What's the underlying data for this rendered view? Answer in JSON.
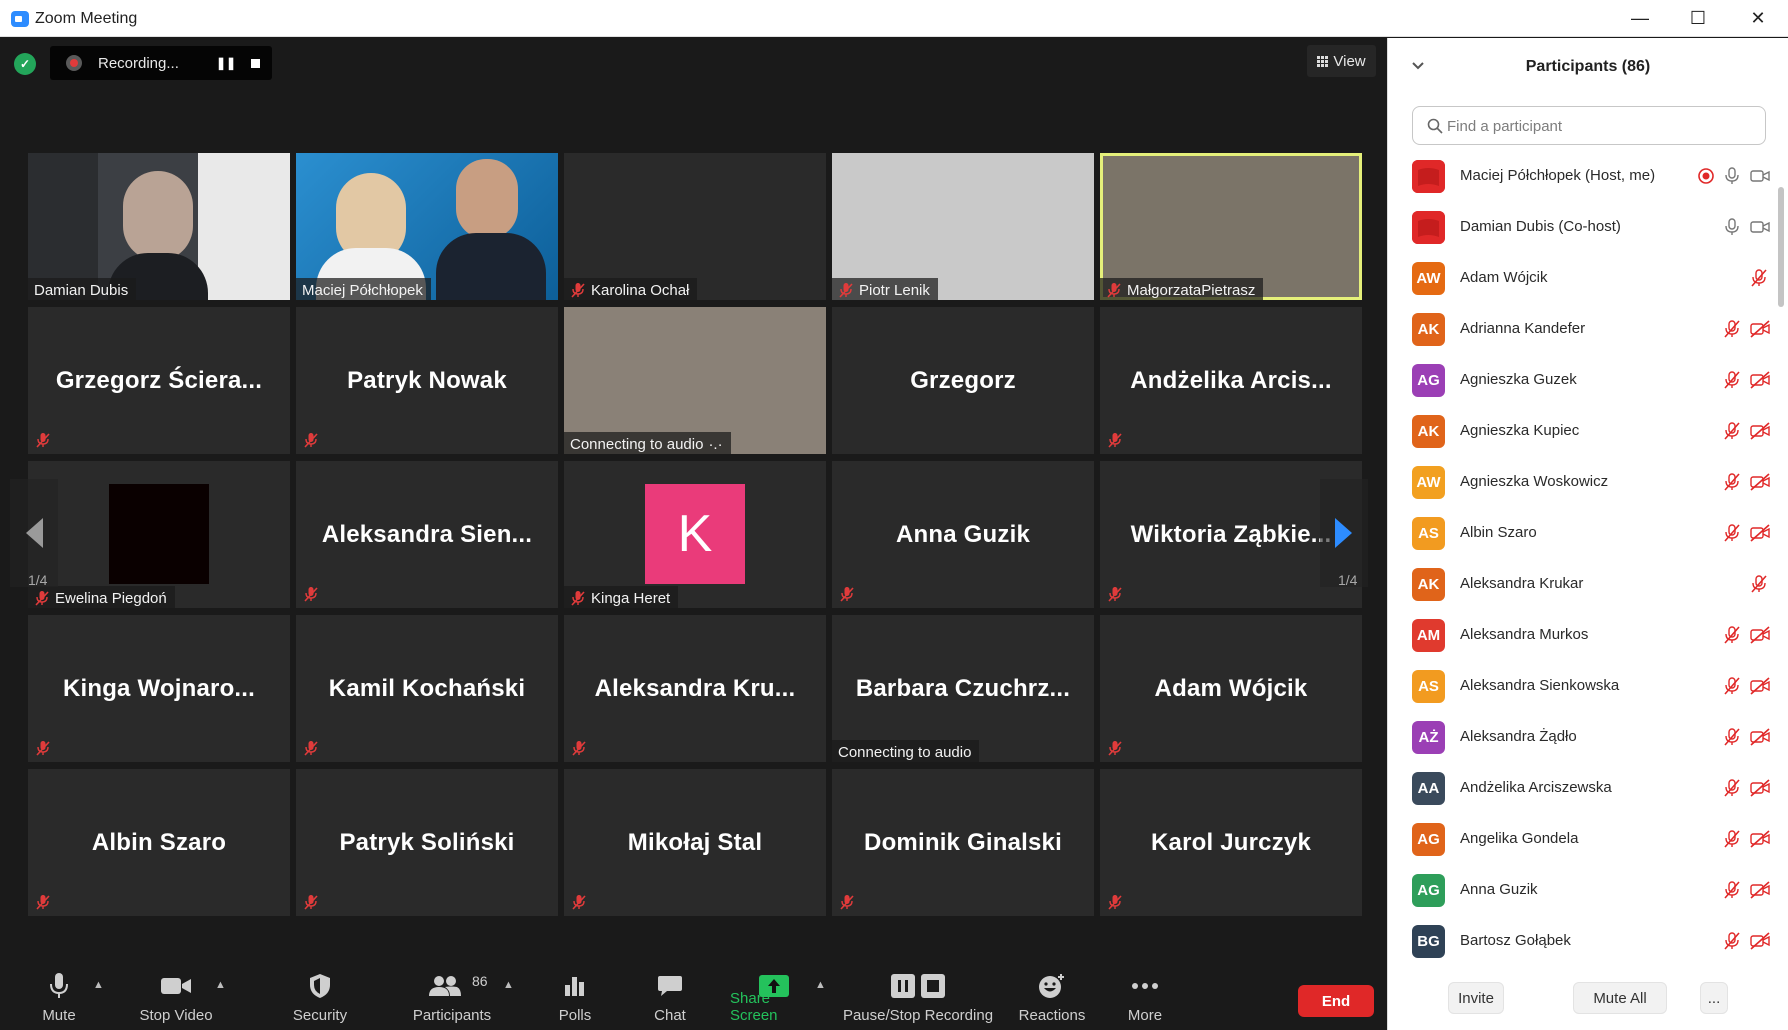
{
  "window": {
    "title": "Zoom Meeting",
    "minimize": "—",
    "maximize": "☐",
    "close": "✕"
  },
  "recording": {
    "label": "Recording...",
    "pause": "❚❚"
  },
  "view": {
    "label": "View"
  },
  "tiles": [
    {
      "name": "Damian Dubis",
      "kind": "video",
      "muted": false,
      "bg": "#3c3f44"
    },
    {
      "name": "Maciej Półchłopek",
      "kind": "video",
      "muted": false,
      "bg": "#1f6ea3"
    },
    {
      "name": "Karolina Ochał",
      "kind": "label",
      "muted": true,
      "bg": "#2a2a2a"
    },
    {
      "name": "Piotr Lenik",
      "kind": "label",
      "muted": true,
      "bg": "#c9c9c9"
    },
    {
      "name": "MałgorzataPietrasz",
      "kind": "label",
      "muted": true,
      "bg": "#7b7468",
      "active": true
    },
    {
      "name": "Grzegorz  Ściera...",
      "kind": "big",
      "muted": true
    },
    {
      "name": "Patryk Nowak",
      "kind": "big",
      "muted": true
    },
    {
      "name": "Connecting to audio",
      "kind": "label",
      "muted": false,
      "bg": "#8a8177",
      "suffix": "·.·"
    },
    {
      "name": "Grzegorz",
      "kind": "big",
      "muted": false
    },
    {
      "name": "Andżelika  Arcis...",
      "kind": "big",
      "muted": true
    },
    {
      "name": "Ewelina Piegdoń",
      "kind": "label",
      "muted": true,
      "avatar": "black"
    },
    {
      "name": "Aleksandra  Sien...",
      "kind": "big",
      "muted": true
    },
    {
      "name": "Kinga Heret",
      "kind": "label",
      "muted": true,
      "avatar": "K"
    },
    {
      "name": "Anna Guzik",
      "kind": "big",
      "muted": true
    },
    {
      "name": "Wiktoria  Ząbkie...",
      "kind": "big",
      "muted": true
    },
    {
      "name": "Kinga  Wojnaro...",
      "kind": "big",
      "muted": true
    },
    {
      "name": "Kamil Kochański",
      "kind": "big",
      "muted": true
    },
    {
      "name": "Aleksandra  Kru...",
      "kind": "big",
      "muted": true
    },
    {
      "name": "Barbara  Czuchrz...",
      "kind": "big",
      "muted": false,
      "connecting": "Connecting to audio"
    },
    {
      "name": "Adam Wójcik",
      "kind": "big",
      "muted": true
    },
    {
      "name": "Albin Szaro",
      "kind": "big",
      "muted": true
    },
    {
      "name": "Patryk Soliński",
      "kind": "big",
      "muted": true
    },
    {
      "name": "Mikołaj Stal",
      "kind": "big",
      "muted": true
    },
    {
      "name": "Dominik Ginalski",
      "kind": "big",
      "muted": true
    },
    {
      "name": "Karol Jurczyk",
      "kind": "big",
      "muted": true
    }
  ],
  "kinga_avatar_letter": "K",
  "pager": {
    "left": "1/4",
    "right": "1/4"
  },
  "toolbar": {
    "mute": "Mute",
    "stop_video": "Stop Video",
    "security": "Security",
    "participants": "Participants",
    "participants_count": "86",
    "polls": "Polls",
    "chat": "Chat",
    "share_screen": "Share Screen",
    "pause_stop_recording": "Pause/Stop Recording",
    "reactions": "Reactions",
    "more": "More",
    "end": "End"
  },
  "panel": {
    "title": "Participants (86)",
    "search_placeholder": "Find a participant",
    "invite": "Invite",
    "mute_all": "Mute All",
    "more": "...",
    "participants": [
      {
        "name": "Maciej Półchłopek (Host, me)",
        "initials": "",
        "color": "#e02828",
        "icons": [
          "rec",
          "mic",
          "cam"
        ]
      },
      {
        "name": "Damian Dubis (Co-host)",
        "initials": "",
        "color": "#e02828",
        "icons": [
          "mic",
          "cam"
        ]
      },
      {
        "name": "Adam Wójcik",
        "initials": "AW",
        "color": "#e56a12",
        "icons": [
          "micoff"
        ]
      },
      {
        "name": "Adrianna Kandefer",
        "initials": "AK",
        "color": "#e0641a",
        "icons": [
          "micoff",
          "camoff"
        ]
      },
      {
        "name": "Agnieszka Guzek",
        "initials": "AG",
        "color": "#9b3fb5",
        "icons": [
          "micoff",
          "camoff"
        ]
      },
      {
        "name": "Agnieszka Kupiec",
        "initials": "AK",
        "color": "#e0641a",
        "icons": [
          "micoff",
          "camoff"
        ]
      },
      {
        "name": "Agnieszka Woskowicz",
        "initials": "AW",
        "color": "#f2a020",
        "icons": [
          "micoff",
          "camoff"
        ]
      },
      {
        "name": "Albin Szaro",
        "initials": "AS",
        "color": "#f29b20",
        "icons": [
          "micoff",
          "camoff"
        ]
      },
      {
        "name": "Aleksandra Krukar",
        "initials": "AK",
        "color": "#e0641a",
        "icons": [
          "micoff"
        ]
      },
      {
        "name": "Aleksandra Murkos",
        "initials": "AM",
        "color": "#e03a2e",
        "icons": [
          "micoff",
          "camoff"
        ]
      },
      {
        "name": "Aleksandra Sienkowska",
        "initials": "AS",
        "color": "#f29b20",
        "icons": [
          "micoff",
          "camoff"
        ]
      },
      {
        "name": "Aleksandra Żądło",
        "initials": "AŻ",
        "color": "#9b3fb5",
        "icons": [
          "micoff",
          "camoff"
        ]
      },
      {
        "name": "Andżelika Arciszewska",
        "initials": "AA",
        "color": "#3a4a5c",
        "icons": [
          "micoff",
          "camoff"
        ]
      },
      {
        "name": "Angelika Gondela",
        "initials": "AG",
        "color": "#e0641a",
        "icons": [
          "micoff",
          "camoff"
        ]
      },
      {
        "name": "Anna Guzik",
        "initials": "AG",
        "color": "#2e9e5a",
        "icons": [
          "micoff",
          "camoff"
        ]
      },
      {
        "name": "Bartosz Gołąbek",
        "initials": "BG",
        "color": "#2f4256",
        "icons": [
          "micoff",
          "camoff"
        ]
      }
    ]
  }
}
